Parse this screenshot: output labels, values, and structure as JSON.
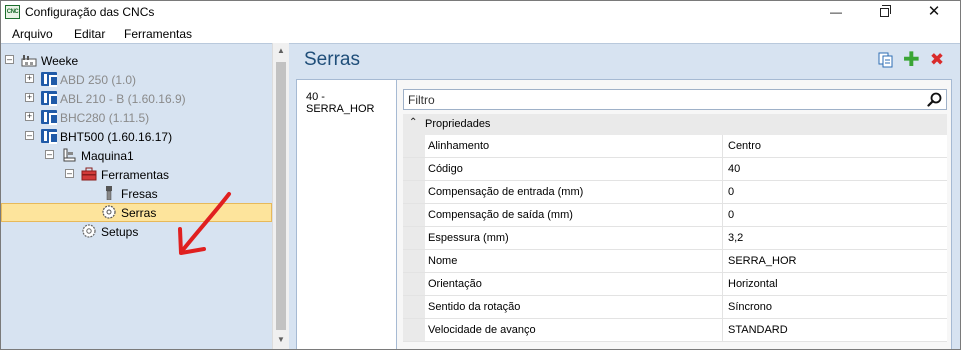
{
  "window": {
    "title": "Configuração das CNCs",
    "app_icon_text": "CNC"
  },
  "menu": [
    "Arquivo",
    "Editar",
    "Ferramentas"
  ],
  "tree": {
    "root": "Weeke",
    "machines": [
      {
        "label": "ABD 250 (1.0)",
        "enabled": false
      },
      {
        "label": "ABL 210 - B (1.60.16.9)",
        "enabled": false
      },
      {
        "label": "BHC280 (1.11.5)",
        "enabled": false
      },
      {
        "label": "BHT500 (1.60.16.17)",
        "enabled": true
      }
    ],
    "machine_node": "Maquina1",
    "tools_node": "Ferramentas",
    "fresas": "Fresas",
    "serras": "Serras",
    "setups": "Setups"
  },
  "panel": {
    "title": "Serras",
    "tool_tab": "40 - SERRA_HOR",
    "filter_placeholder": "Filtro",
    "category": "Propriedades",
    "properties": [
      {
        "name": "Alinhamento",
        "value": "Centro"
      },
      {
        "name": "Código",
        "value": "40"
      },
      {
        "name": "Compensação de entrada (mm)",
        "value": "0"
      },
      {
        "name": "Compensação de saída (mm)",
        "value": "0"
      },
      {
        "name": "Espessura (mm)",
        "value": "3,2"
      },
      {
        "name": "Nome",
        "value": "SERRA_HOR"
      },
      {
        "name": "Orientação",
        "value": "Horizontal"
      },
      {
        "name": "Sentido da rotação",
        "value": "Síncrono"
      },
      {
        "name": "Velocidade de avanço",
        "value": "STANDARD"
      }
    ]
  },
  "colors": {
    "pane_bg": "#d7e3f1",
    "selection": "#fde49c",
    "header_text": "#1f4e79",
    "annotation": "#e02020"
  }
}
